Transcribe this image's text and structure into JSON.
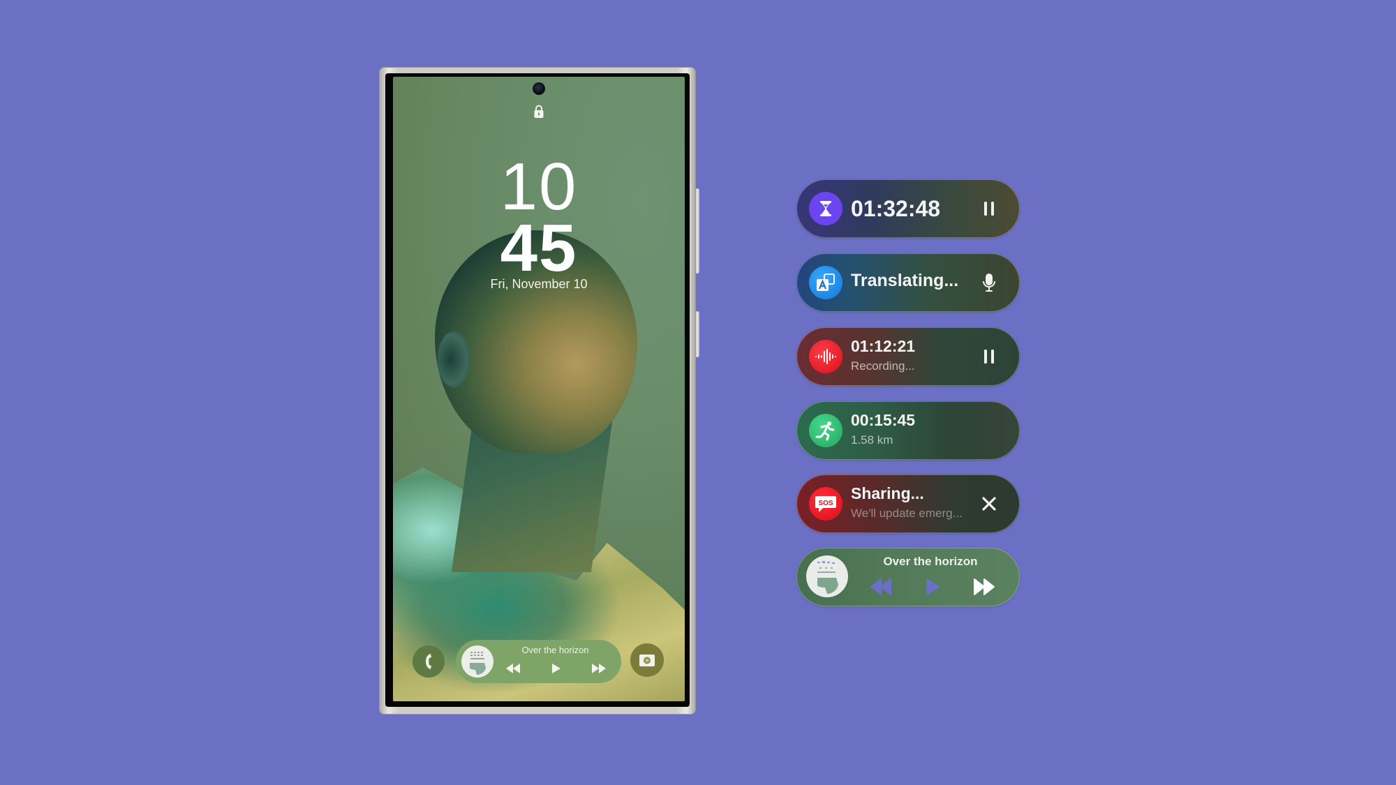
{
  "lock_screen": {
    "clock_hours": "10",
    "clock_minutes": "45",
    "date": "Fri, November 10",
    "media_title": "Over the horizon",
    "shortcuts": {
      "left": "phone-icon",
      "right": "camera-icon"
    }
  },
  "live_notifications": [
    {
      "type": "timer",
      "icon": "hourglass-icon",
      "icon_color": "#6a45f0",
      "primary": "01:32:48",
      "action": "pause-icon"
    },
    {
      "type": "translate",
      "icon": "translate-icon",
      "icon_color": "#1d8fe6",
      "primary": "Translating...",
      "action": "microphone-icon"
    },
    {
      "type": "recorder",
      "icon": "sound-wave-icon",
      "icon_color": "#e51d2a",
      "primary": "01:12:21",
      "secondary": "Recording...",
      "action": "pause-icon"
    },
    {
      "type": "workout",
      "icon": "running-icon",
      "icon_color": "#2fbf70",
      "primary": "00:15:45",
      "secondary": "1.58 km"
    },
    {
      "type": "emergency-sharing",
      "icon": "sos-icon",
      "icon_color": "#e4141f",
      "primary": "Sharing...",
      "secondary": "We'll update emerg...",
      "action": "close-icon"
    },
    {
      "type": "media",
      "icon": "album-art",
      "primary": "Over the horizon",
      "controls": [
        "rewind-icon",
        "play-icon",
        "fast-forward-icon"
      ]
    }
  ],
  "colors": {
    "background": "#6b70c4"
  }
}
